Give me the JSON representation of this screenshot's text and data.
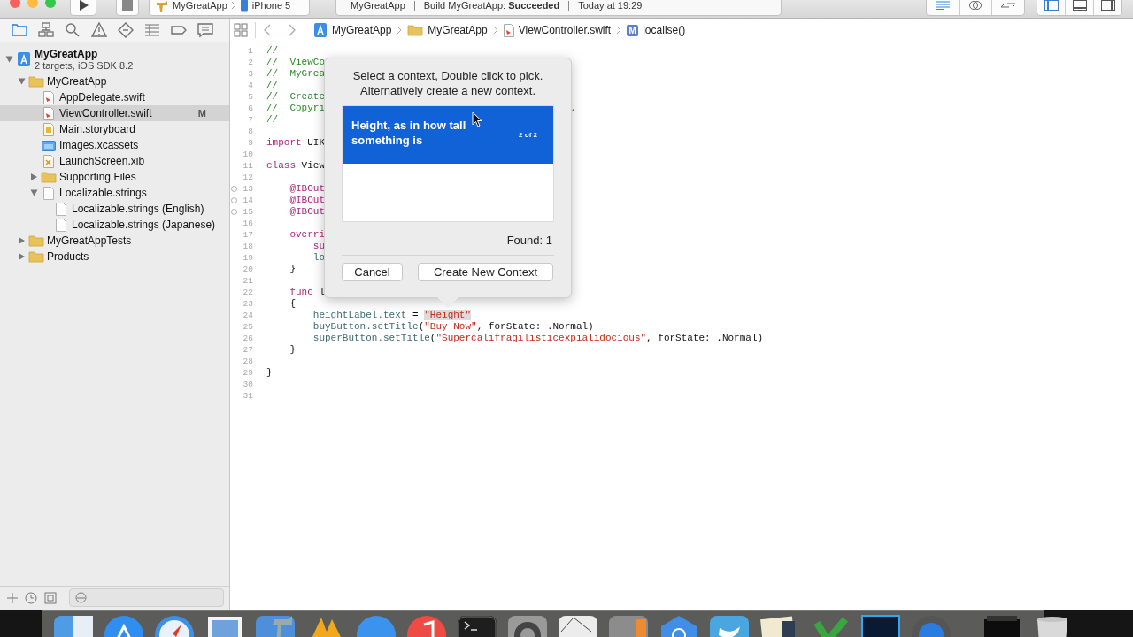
{
  "toolbar": {
    "scheme": "MyGreatApp",
    "device": "iPhone 5",
    "activity": [
      "MyGreatApp",
      "Build MyGreatApp: **Succeeded**",
      "Today at 19:29"
    ]
  },
  "navigator_tabs": [
    {
      "kind": "project",
      "selected": true
    },
    {
      "kind": "symbol",
      "selected": false
    },
    {
      "kind": "find",
      "selected": false
    },
    {
      "kind": "issue",
      "selected": false
    },
    {
      "kind": "test",
      "selected": false
    },
    {
      "kind": "debug",
      "selected": false
    },
    {
      "kind": "breakpoint",
      "selected": false
    },
    {
      "kind": "report",
      "selected": false
    }
  ],
  "jump_bar": [
    {
      "kind": "project",
      "label": "MyGreatApp"
    },
    {
      "kind": "folder",
      "label": "MyGreatApp"
    },
    {
      "kind": "swift",
      "label": "ViewController.swift"
    },
    {
      "kind": "method",
      "label": "localise()",
      "icon_letter": "M"
    }
  ],
  "navigator": {
    "tree": [
      {
        "name": "MyGreatApp",
        "subtitle": "2 targets, iOS SDK 8.2",
        "kind": "project",
        "expanded": true,
        "selected": false,
        "children": [
          {
            "name": "MyGreatApp",
            "kind": "folder",
            "expanded": true,
            "selected": false,
            "children": [
              {
                "name": "AppDelegate.swift",
                "kind": "swift",
                "selected": false
              },
              {
                "name": "ViewController.swift",
                "kind": "swift",
                "selected": true,
                "badge": "M"
              },
              {
                "name": "Main.storyboard",
                "kind": "storyboard",
                "selected": false
              },
              {
                "name": "Images.xcassets",
                "kind": "assets",
                "selected": false
              },
              {
                "name": "LaunchScreen.xib",
                "kind": "xib",
                "selected": false
              },
              {
                "name": "Supporting Files",
                "kind": "folder",
                "expanded": false,
                "selected": false
              },
              {
                "name": "Localizable.strings",
                "kind": "strings",
                "expanded": true,
                "selected": false,
                "children": [
                  {
                    "name": "Localizable.strings (English)",
                    "kind": "strings",
                    "selected": false
                  },
                  {
                    "name": "Localizable.strings (Japanese)",
                    "kind": "strings",
                    "selected": false
                  }
                ]
              }
            ]
          },
          {
            "name": "MyGreatAppTests",
            "kind": "folder",
            "expanded": false,
            "selected": false
          },
          {
            "name": "Products",
            "kind": "folder",
            "expanded": false,
            "selected": false
          }
        ]
      }
    ]
  },
  "editor": {
    "lines": [
      {
        "number": "1",
        "outlet": false,
        "segments": [
          {
            "kind": "comment",
            "text": "//"
          }
        ]
      },
      {
        "number": "2",
        "outlet": false,
        "segments": [
          {
            "kind": "comment",
            "text": "//  ViewCo"
          }
        ]
      },
      {
        "number": "3",
        "outlet": false,
        "segments": [
          {
            "kind": "comment",
            "text": "//  MyGrea"
          }
        ]
      },
      {
        "number": "4",
        "outlet": false,
        "segments": [
          {
            "kind": "comment",
            "text": "//"
          }
        ]
      },
      {
        "number": "5",
        "outlet": false,
        "segments": [
          {
            "kind": "comment",
            "text": "//  Create"
          }
        ]
      },
      {
        "number": "6",
        "outlet": false,
        "segments": [
          {
            "kind": "comment",
            "text": "//  Copyri"
          },
          {
            "kind": "comment_end",
            "text": "."
          }
        ]
      },
      {
        "number": "7",
        "outlet": false,
        "segments": [
          {
            "kind": "comment",
            "text": "//"
          }
        ]
      },
      {
        "number": "8",
        "outlet": false
      },
      {
        "number": "9",
        "outlet": false,
        "segments": [
          {
            "kind": "keyword",
            "text": "import"
          },
          {
            "kind": "plain",
            "text": " UIK"
          }
        ]
      },
      {
        "number": "10",
        "outlet": false
      },
      {
        "number": "11",
        "outlet": false,
        "segments": [
          {
            "kind": "keyword",
            "text": "class"
          },
          {
            "kind": "plain",
            "text": " View"
          }
        ]
      },
      {
        "number": "12",
        "outlet": false
      },
      {
        "number": "13",
        "outlet": true,
        "segments": [
          {
            "kind": "attribute",
            "text": "    @IBOut"
          }
        ]
      },
      {
        "number": "14",
        "outlet": true,
        "segments": [
          {
            "kind": "attribute",
            "text": "    @IBOut"
          }
        ]
      },
      {
        "number": "15",
        "outlet": true,
        "segments": [
          {
            "kind": "attribute",
            "text": "    @IBOut"
          }
        ]
      },
      {
        "number": "16",
        "outlet": false
      },
      {
        "number": "17",
        "outlet": false,
        "segments": [
          {
            "kind": "keyword",
            "text": "    overri"
          }
        ]
      },
      {
        "number": "18",
        "outlet": false,
        "segments": [
          {
            "kind": "keyword",
            "text": "        su"
          }
        ]
      },
      {
        "number": "19",
        "outlet": false,
        "segments": [
          {
            "kind": "ident",
            "text": "        lo"
          }
        ]
      },
      {
        "number": "20",
        "outlet": false,
        "segments": [
          {
            "kind": "plain",
            "text": "    }"
          }
        ]
      },
      {
        "number": "21",
        "outlet": false
      },
      {
        "number": "22",
        "outlet": false,
        "segments": [
          {
            "kind": "keyword",
            "text": "    func"
          },
          {
            "kind": "plain",
            "text": " l"
          }
        ]
      },
      {
        "number": "23",
        "outlet": false,
        "segments": [
          {
            "kind": "plain",
            "text": "    {"
          }
        ]
      },
      {
        "number": "24",
        "outlet": false,
        "segments": [
          {
            "kind": "ident",
            "text": "        heightLabel.text"
          },
          {
            "kind": "plain",
            "text": " = "
          },
          {
            "kind": "selected_string",
            "text": "\"Height\""
          }
        ]
      },
      {
        "number": "25",
        "outlet": false,
        "segments": [
          {
            "kind": "ident",
            "text": "        buyButton.setTitle"
          },
          {
            "kind": "plain",
            "text": "("
          },
          {
            "kind": "string",
            "text": "\"Buy Now\""
          },
          {
            "kind": "plain",
            "text": ", forState: .Normal)"
          }
        ]
      },
      {
        "number": "26",
        "outlet": false,
        "segments": [
          {
            "kind": "ident",
            "text": "        superButton.setTitle"
          },
          {
            "kind": "plain",
            "text": "("
          },
          {
            "kind": "string",
            "text": "\"Supercalifragilisticexpialidocious\""
          },
          {
            "kind": "plain",
            "text": ", forState: .Normal)"
          }
        ]
      },
      {
        "number": "27",
        "outlet": false,
        "segments": [
          {
            "kind": "plain",
            "text": "    }"
          }
        ]
      },
      {
        "number": "28",
        "outlet": false
      },
      {
        "number": "29",
        "outlet": false,
        "segments": [
          {
            "kind": "plain",
            "text": "}"
          }
        ]
      },
      {
        "number": "30",
        "outlet": false
      },
      {
        "number": "31",
        "outlet": false
      }
    ]
  },
  "popover": {
    "message": "Select a context, Double click to pick.\nAlternatively create a new context.",
    "contexts": [
      {
        "text": "Height, as in how tall something is",
        "count": "2 of 2",
        "selected": true
      }
    ],
    "found": "Found: 1",
    "buttons": [
      {
        "kind": "cancel",
        "label": "Cancel"
      },
      {
        "kind": "create",
        "label": "Create New Context"
      }
    ]
  }
}
